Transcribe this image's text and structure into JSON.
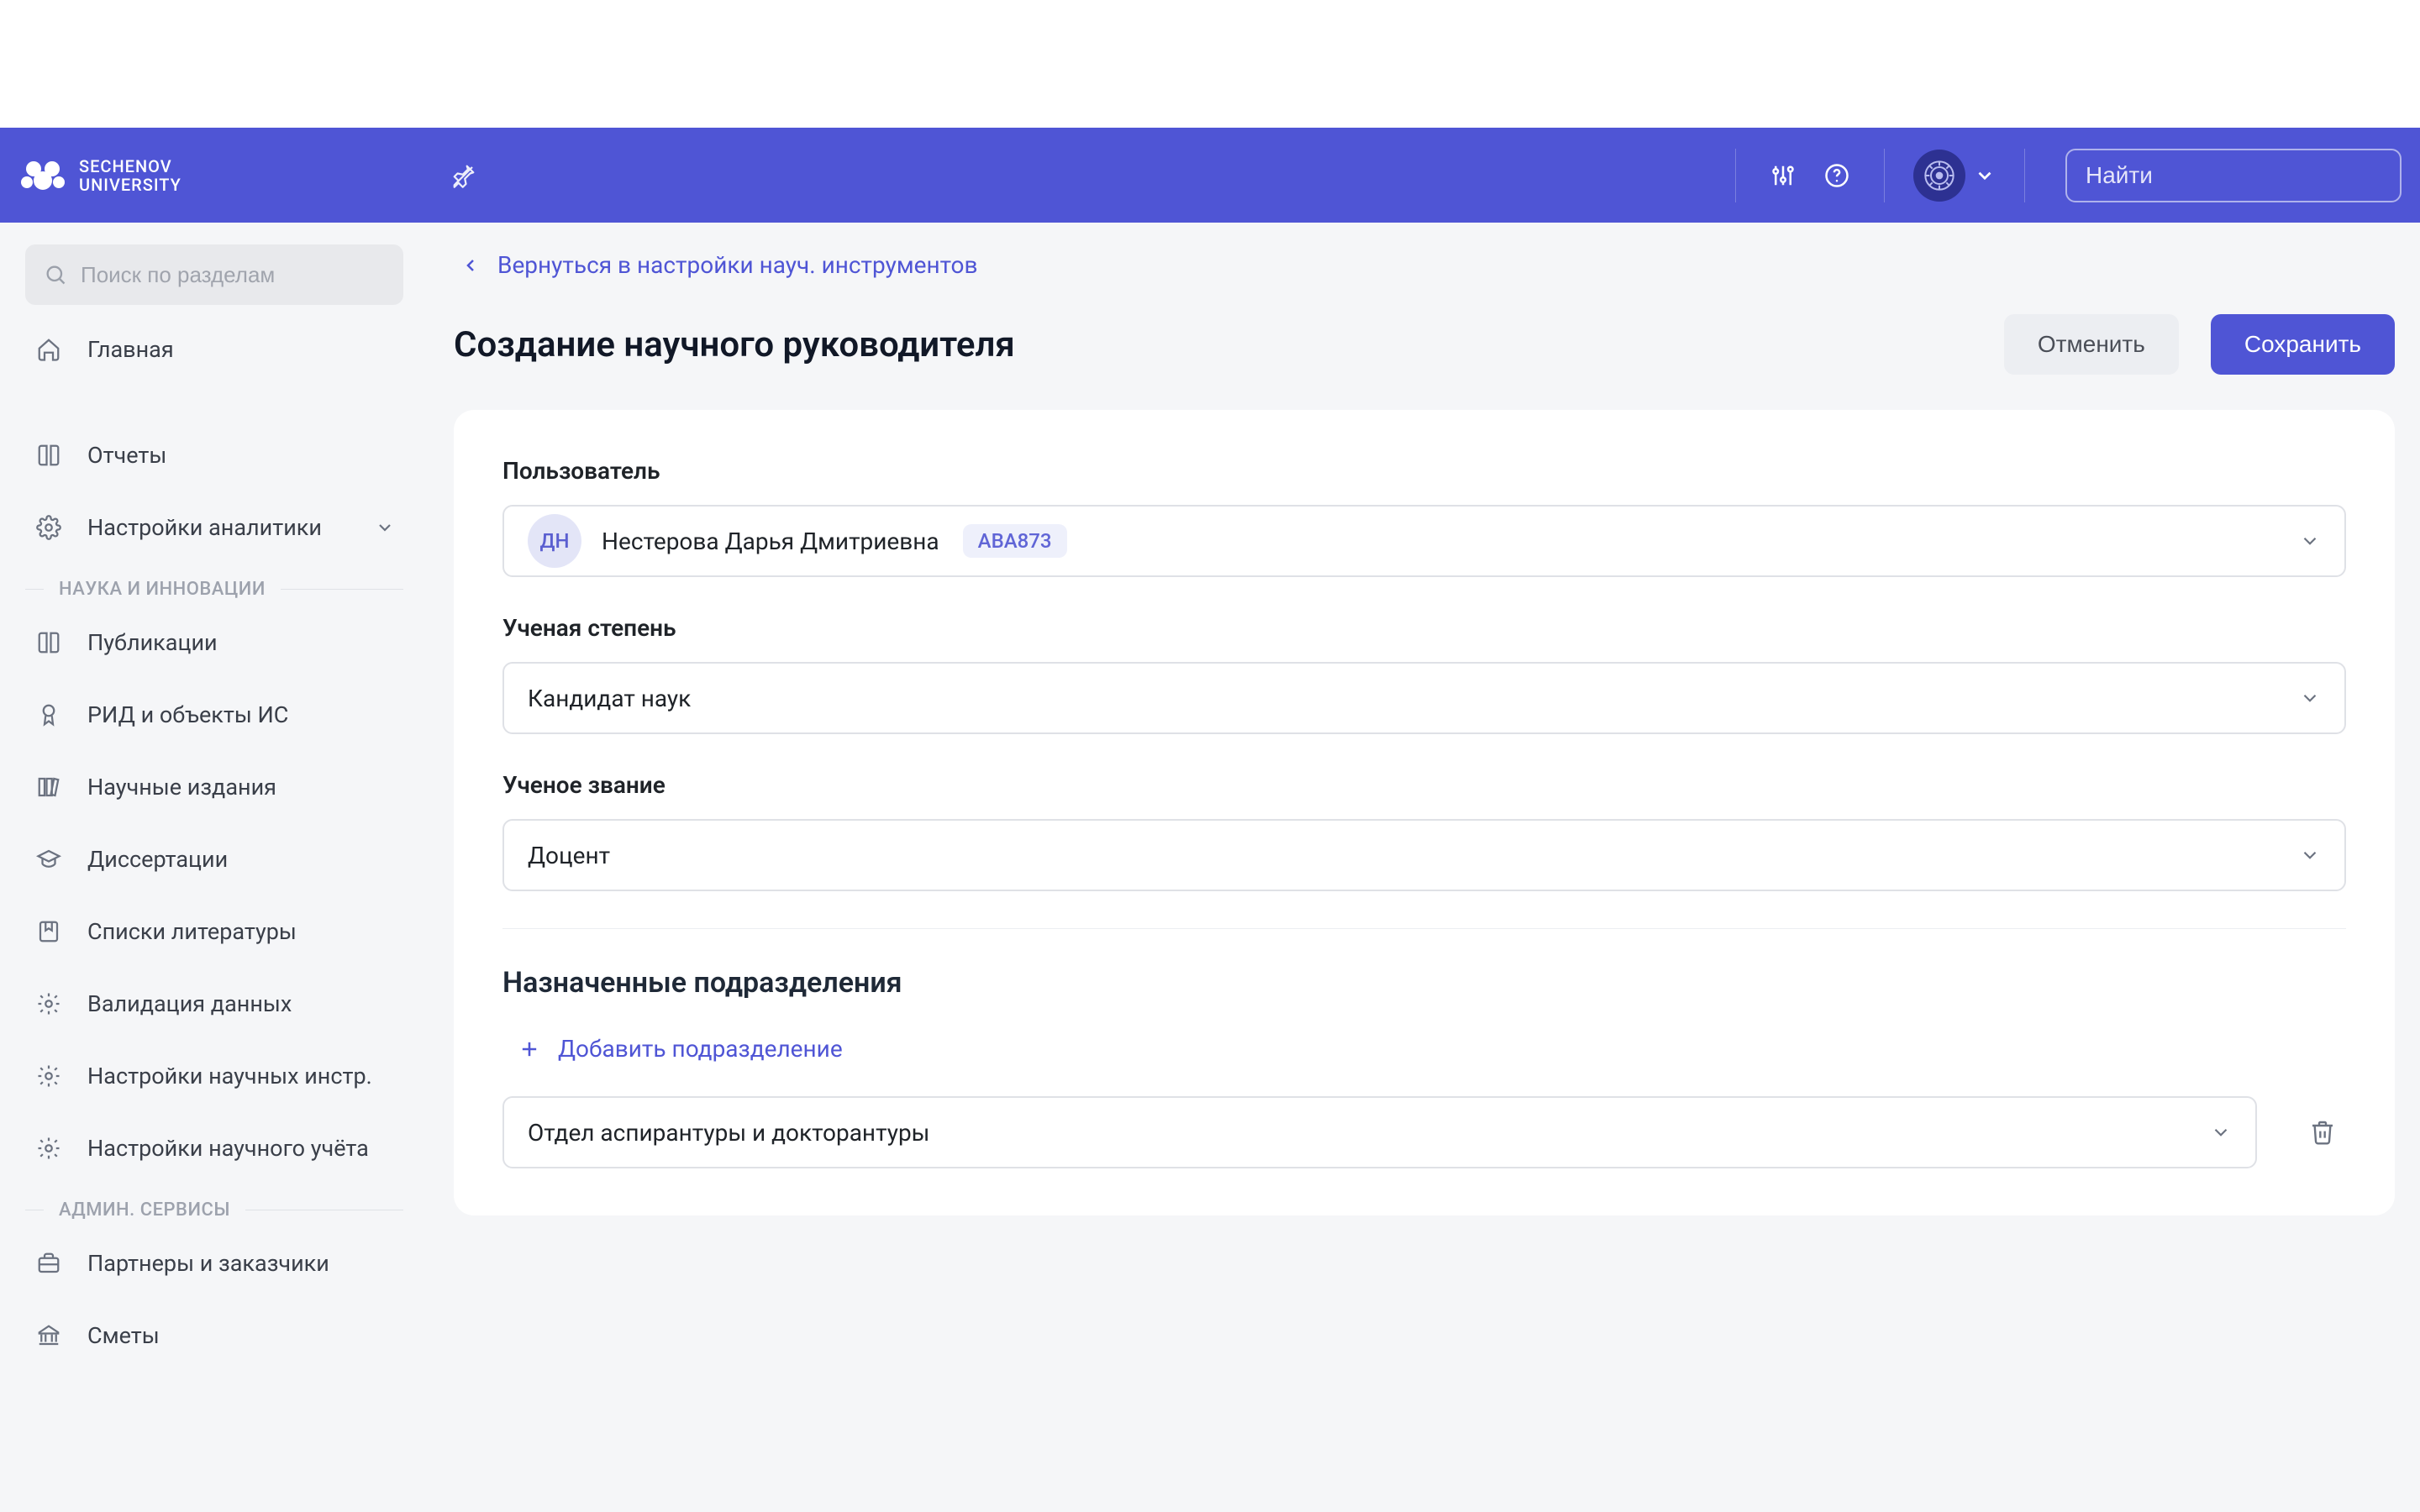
{
  "header": {
    "logo_top": "SECHENOV",
    "logo_bottom": "UNIVERSITY",
    "search_placeholder": "Найти"
  },
  "sidebar": {
    "search_placeholder": "Поиск по разделам",
    "item_glavnaya": "Главная",
    "item_otchety": "Отчеты",
    "item_nastroy_analytics": "Настройки аналитики",
    "section_science": "НАУКА И ИННОВАЦИИ",
    "item_publications": "Публикации",
    "item_rid": "РИД и объекты ИС",
    "item_editions": "Научные издания",
    "item_dissertations": "Диссертации",
    "item_literature": "Списки литературы",
    "item_validation": "Валидация данных",
    "item_sci_instr": "Настройки научных инстр.",
    "item_sci_account": "Настройки научного учёта",
    "section_admin": "АДМИН. СЕРВИСЫ",
    "item_partners": "Партнеры и заказчики",
    "item_smety": "Сметы"
  },
  "main": {
    "back_label": "Вернуться в настройки науч. инструментов",
    "page_title": "Создание научного руководителя",
    "cancel_label": "Отменить",
    "save_label": "Сохранить",
    "form": {
      "user_label": "Пользователь",
      "user_initials": "ДН",
      "user_fullname": "Нестерова Дарья Дмитриевна",
      "user_code": "ABA873",
      "degree_label": "Ученая степень",
      "degree_value": "Кандидат наук",
      "rank_label": "Ученое звание",
      "rank_value": "Доцент",
      "departments_title": "Назначенные подразделения",
      "add_dept_label": "Добавить подразделение",
      "dept_value": "Отдел аспирантуры и докторантуры"
    }
  }
}
